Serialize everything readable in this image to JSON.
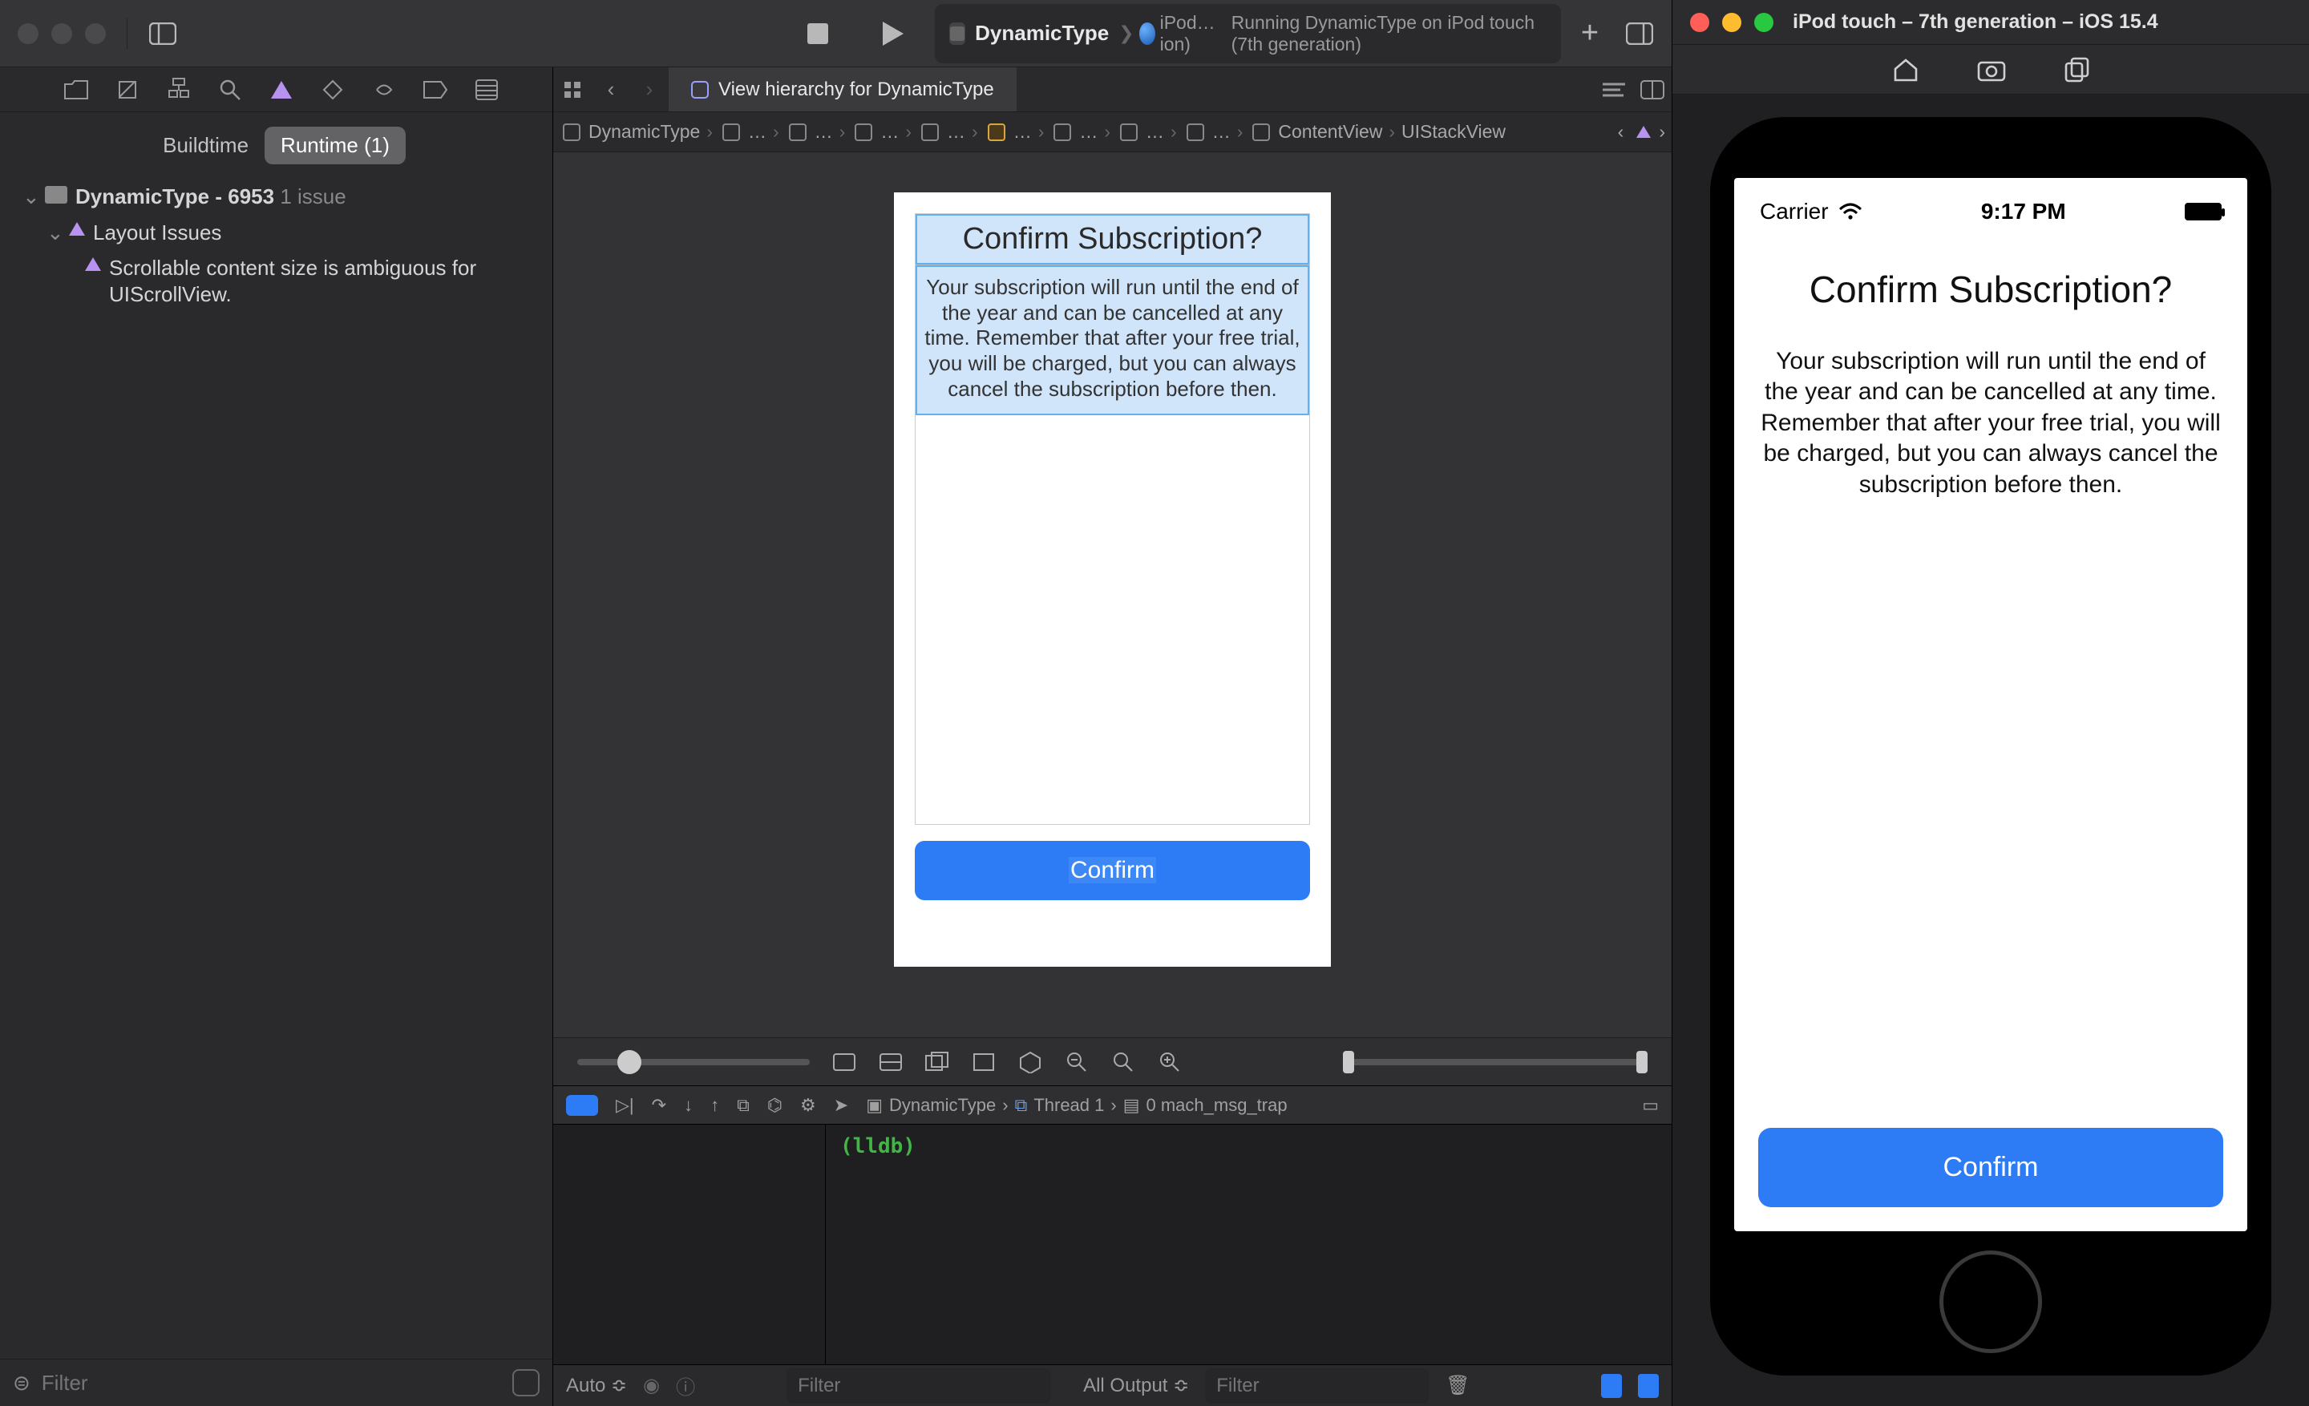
{
  "xcode": {
    "project_name": "DynamicType",
    "scheme_label": "iPod…ion)",
    "status_text": "Running DynamicType on iPod touch (7th generation)",
    "tab_title": "View hierarchy for DynamicType",
    "navigator": {
      "segments": {
        "buildtime": "Buildtime",
        "runtime": "Runtime (1)"
      },
      "root_label": "DynamicType - 6953",
      "root_count": "1 issue",
      "category_label": "Layout Issues",
      "issue_message": "Scrollable content size is ambiguous for UIScrollView.",
      "filter_placeholder": "Filter"
    },
    "jumpbar": {
      "root": "DynamicType",
      "content_view": "ContentView",
      "stack_view": "UIStackView"
    },
    "preview": {
      "title": "Confirm Subscription?",
      "body": "Your subscription will run until the end of the year and can be cancelled at any time. Remember that after your free trial, you will be charged, but you can always cancel the subscription before then.",
      "button": "Confirm"
    },
    "debug": {
      "crumbs_app": "DynamicType",
      "crumbs_thread": "Thread 1",
      "crumbs_frame": "0 mach_msg_trap",
      "lldb_prompt": "(lldb)",
      "auto_label": "Auto ≎",
      "filter_placeholder": "Filter",
      "output_label": "All Output ≎"
    }
  },
  "simulator": {
    "window_title": "iPod touch – 7th generation – iOS 15.4",
    "statusbar": {
      "carrier": "Carrier",
      "time": "9:17 PM"
    },
    "app": {
      "title": "Confirm Subscription?",
      "body": "Your subscription will run until the end of the year and can be cancelled at any time. Remember that after your free trial, you will be charged, but you can always cancel the subscription before then.",
      "button": "Confirm"
    }
  }
}
